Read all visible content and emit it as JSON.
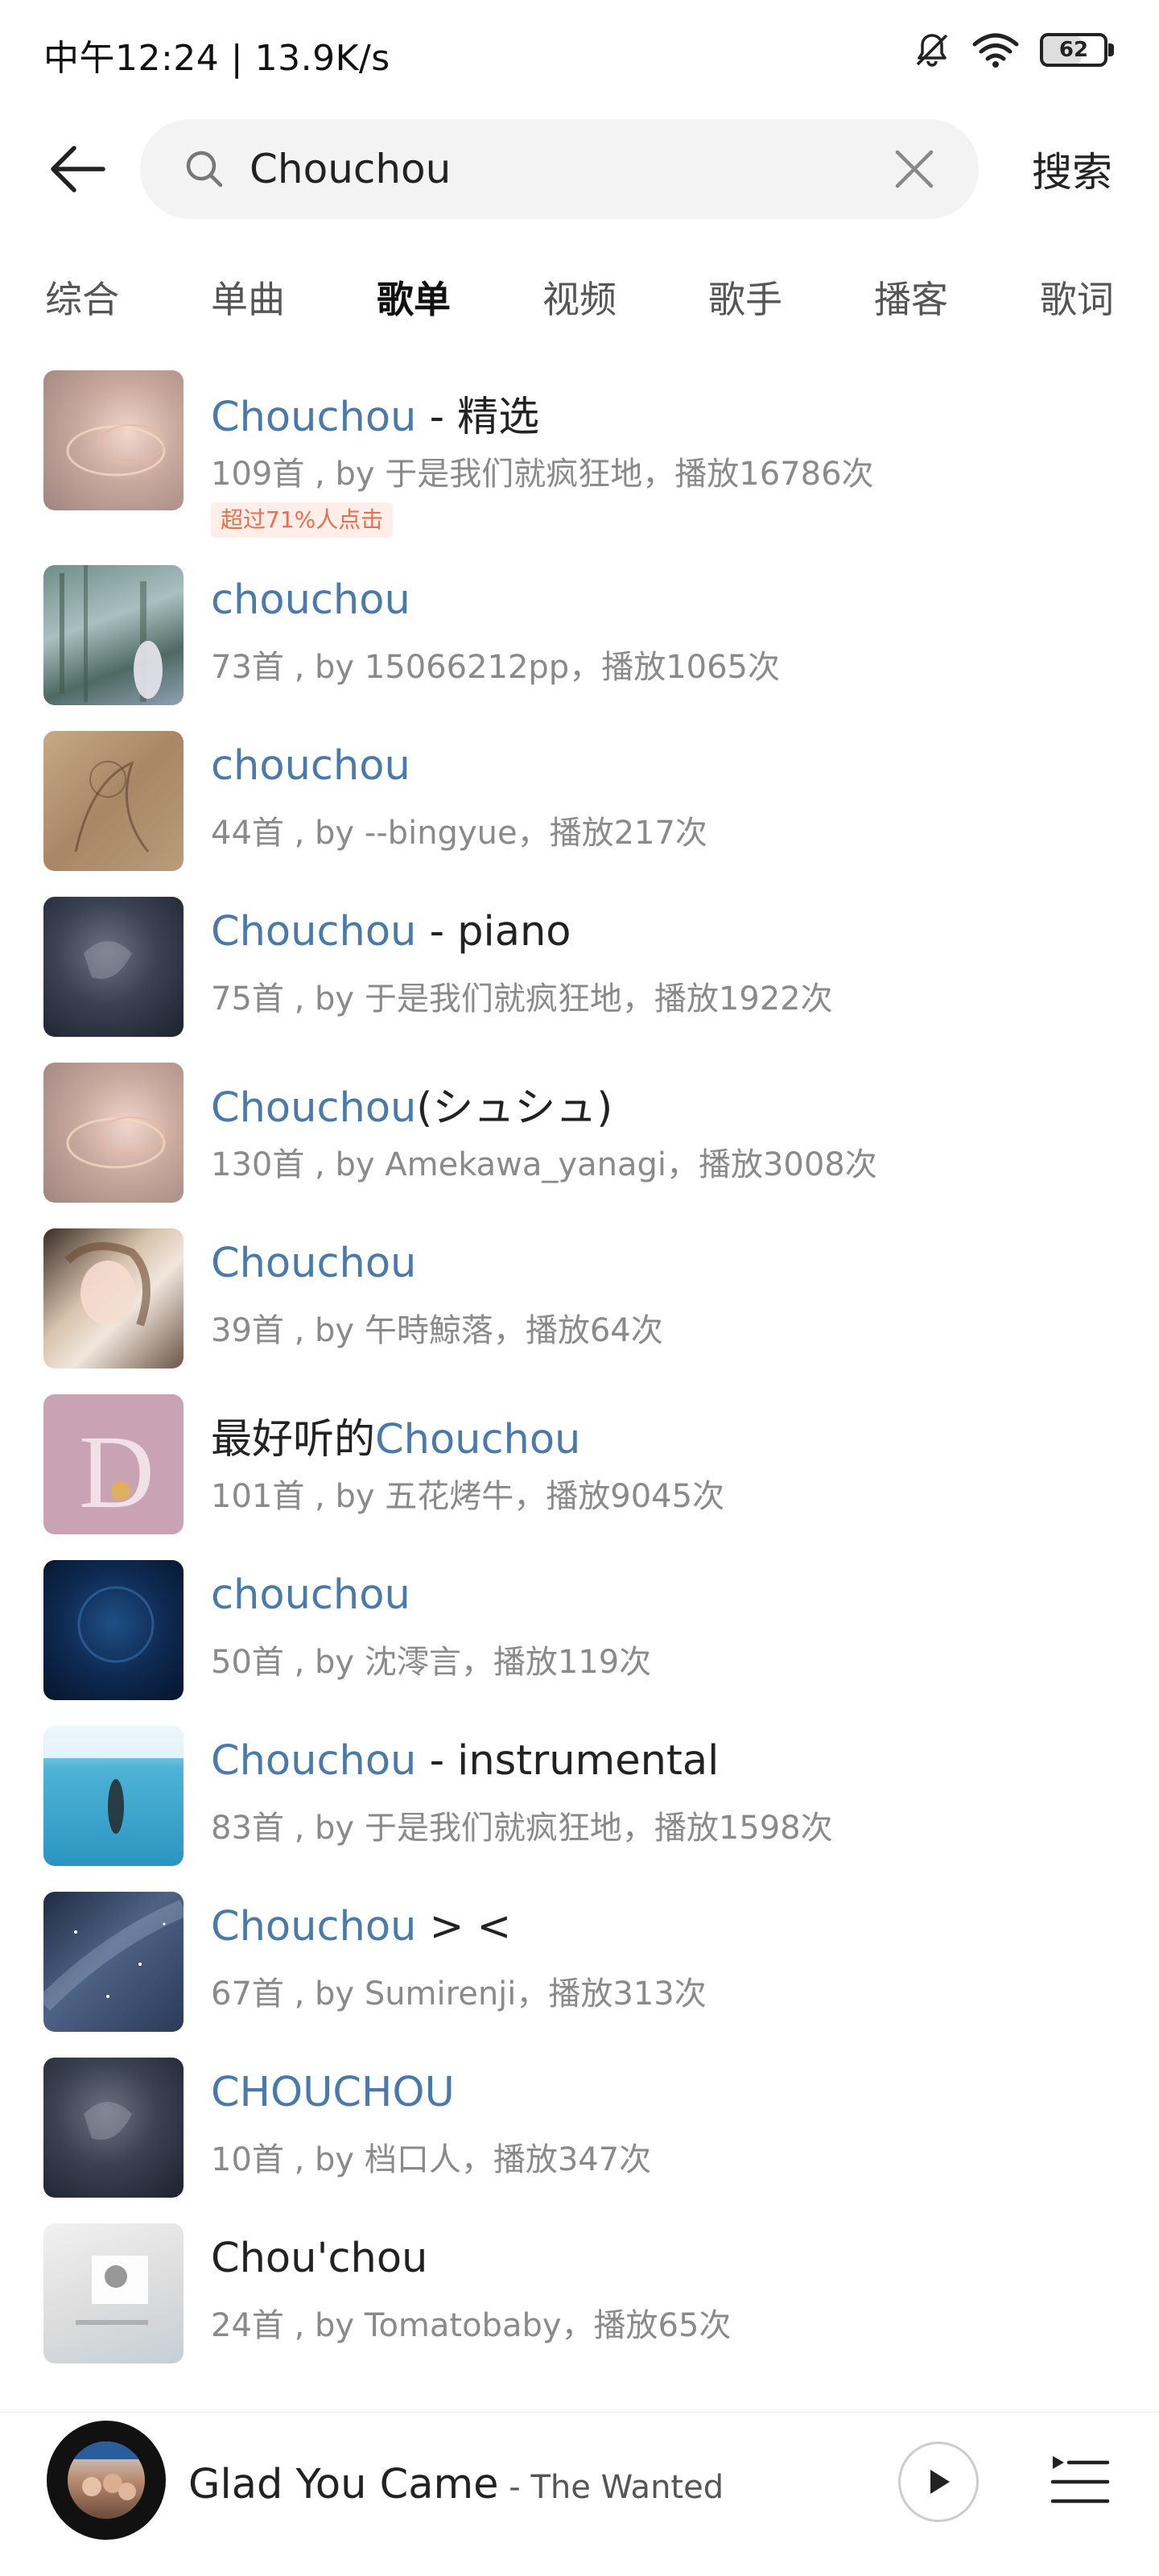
{
  "status_bar": {
    "time": "中午12:24 | 13.9K/s",
    "battery": "62",
    "icons": [
      "bell-off-icon",
      "wifi-icon",
      "battery-icon"
    ]
  },
  "search": {
    "query": "Chouchou",
    "placeholder": "",
    "submit_label": "搜索"
  },
  "tabs": [
    {
      "label": "综合",
      "active": false
    },
    {
      "label": "单曲",
      "active": false
    },
    {
      "label": "歌单",
      "active": true
    },
    {
      "label": "视频",
      "active": false
    },
    {
      "label": "歌手",
      "active": false
    },
    {
      "label": "播客",
      "active": false
    },
    {
      "label": "歌词",
      "active": false
    }
  ],
  "playlists": [
    {
      "title_hl": "Chouchou",
      "title_rest": " - 精选",
      "meta": "109首 , by 于是我们就疯狂地，播放16786次",
      "badge": "超过71%人点击"
    },
    {
      "title_hl": "chouchou",
      "title_rest": "",
      "meta": "73首 , by 15066212pp，播放1065次"
    },
    {
      "title_hl": "chouchou",
      "title_rest": "",
      "meta": "44首 , by --bingyue，播放217次"
    },
    {
      "title_hl": "Chouchou",
      "title_rest": " - piano",
      "meta": "75首 , by 于是我们就疯狂地，播放1922次"
    },
    {
      "title_hl": "Chouchou",
      "title_rest": "(シュシュ)",
      "meta": "130首 , by Amekawa_yanagi，播放3008次"
    },
    {
      "title_hl": "Chouchou",
      "title_rest": "",
      "meta": "39首 , by 午時鯨落，播放64次"
    },
    {
      "title_pre": "最好听的",
      "title_hl": "Chouchou",
      "title_rest": "",
      "meta": "101首 , by 五花烤牛，播放9045次"
    },
    {
      "title_hl": "chouchou",
      "title_rest": "",
      "meta": "50首 , by 沈澪言，播放119次"
    },
    {
      "title_hl": "Chouchou",
      "title_rest": " - instrumental",
      "meta": "83首 , by 于是我们就疯狂地，播放1598次"
    },
    {
      "title_hl": "Chouchou",
      "title_rest": " > <",
      "meta": "67首 , by Sumirenji，播放313次"
    },
    {
      "title_hl": "CHOUCHOU",
      "title_rest": "",
      "meta": "10首 , by 档口人，播放347次"
    },
    {
      "title_hl": "",
      "title_rest": "Chou'chou",
      "meta": "24首 , by Tomatobaby，播放65次"
    }
  ],
  "player": {
    "song": "Glad You Came",
    "separator": " - ",
    "artist": "The Wanted"
  },
  "colors": {
    "highlight": "#4a7aab",
    "tab_underline": "#e8393f",
    "badge_bg": "#fdeeea",
    "badge_text": "#ea6e49"
  }
}
